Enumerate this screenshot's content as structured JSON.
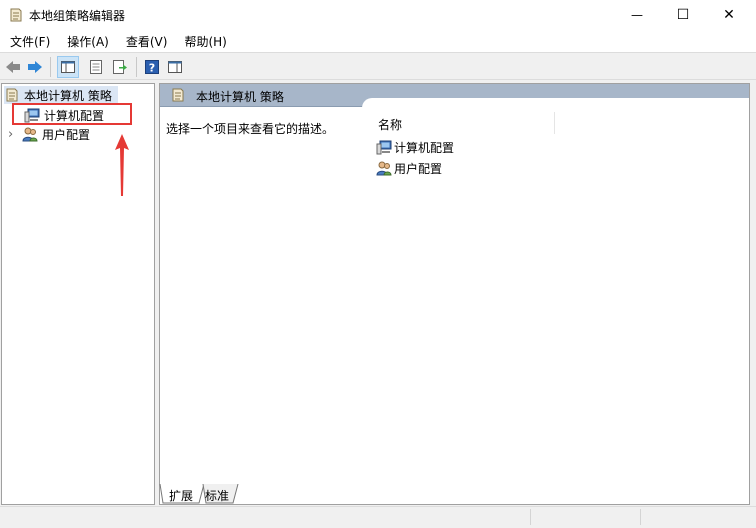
{
  "window": {
    "title": "本地组策略编辑器",
    "controls": {
      "minimize": "—",
      "maximize": "☐",
      "close": "✕"
    }
  },
  "menubar": {
    "items": [
      {
        "label": "文件(F)"
      },
      {
        "label": "操作(A)"
      },
      {
        "label": "查看(V)"
      },
      {
        "label": "帮助(H)"
      }
    ]
  },
  "toolbar": {
    "buttons": [
      "back-icon",
      "forward-icon",
      "show-hide-tree-icon",
      "properties-icon",
      "export-list-icon",
      "help-icon",
      "show-hide-action-pane-icon"
    ]
  },
  "tree": {
    "root": {
      "label": "本地计算机 策略",
      "icon": "policy-scroll-icon"
    },
    "children": [
      {
        "label": "计算机配置",
        "icon": "computer-icon",
        "selected_highlight": true
      },
      {
        "label": "用户配置",
        "icon": "users-icon",
        "expander": "›"
      }
    ]
  },
  "details": {
    "header_title": "本地计算机 策略",
    "description_hint": "选择一个项目来查看它的描述。",
    "column_name": "名称",
    "items": [
      {
        "label": "计算机配置",
        "icon": "computer-icon"
      },
      {
        "label": "用户配置",
        "icon": "users-icon"
      }
    ]
  },
  "tabs": [
    {
      "label": "扩展",
      "active": true
    },
    {
      "label": "标准",
      "active": false
    }
  ],
  "colors": {
    "highlight_box": "#e53935",
    "arrow": "#e53935",
    "header_bg": "#a7b6c9",
    "tree_selected_bg": "#dbe6f4"
  }
}
